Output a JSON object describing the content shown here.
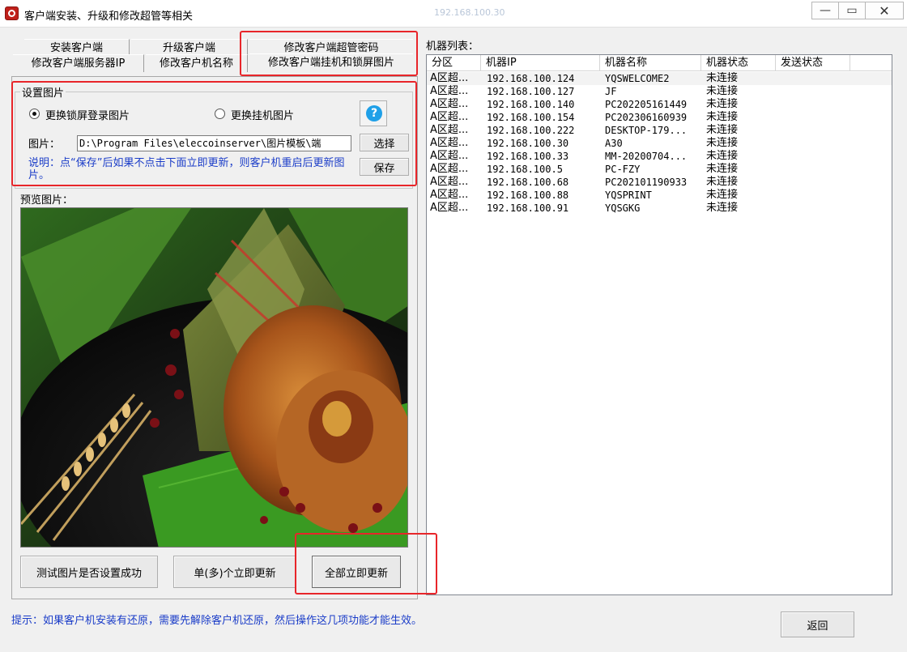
{
  "window": {
    "title": "客户端安装、升级和修改超管等相关",
    "ghost_text": "192.168.100.30",
    "minimize": "—",
    "maximize": "▭",
    "close": "✕"
  },
  "tabs": [
    {
      "label": "安装客户端"
    },
    {
      "label": "升级客户端"
    },
    {
      "label": "修改客户端超管密码"
    },
    {
      "label": "修改客户端服务器IP"
    },
    {
      "label": "修改客户机名称"
    },
    {
      "label": "修改客户端挂机和锁屏图片"
    }
  ],
  "settings": {
    "group_label": "设置图片",
    "radio_lock_label": "更换锁屏登录图片",
    "radio_idle_label": "更换挂机图片",
    "help_label": "?",
    "path_label": "图片：",
    "path_value": "D:\\Program Files\\eleccoinserver\\图片模板\\端",
    "choose_button": "选择",
    "save_button": "保存",
    "note": "说明：点“保存”后如果不点击下面立即更新，则客户机重启后更新图片。"
  },
  "preview": {
    "label": "预览图片："
  },
  "actions": {
    "test_button": "测试图片是否设置成功",
    "single_update_button": "单(多)个立即更新",
    "all_update_button": "全部立即更新",
    "back_button": "返回"
  },
  "hint": "提示：如果客户机安装有还原，需要先解除客户机还原，然后操作这几项功能才能生效。",
  "machine_list": {
    "label": "机器列表：",
    "columns": [
      "分区",
      "机器IP",
      "机器名称",
      "机器状态",
      "发送状态"
    ],
    "rows": [
      {
        "zone": "A区超...",
        "ip": "192.168.100.124",
        "name": "YQSWELCOME2",
        "status": "未连接",
        "send": ""
      },
      {
        "zone": "A区超...",
        "ip": "192.168.100.127",
        "name": "JF",
        "status": "未连接",
        "send": ""
      },
      {
        "zone": "A区超...",
        "ip": "192.168.100.140",
        "name": "PC202205161449",
        "status": "未连接",
        "send": ""
      },
      {
        "zone": "A区超...",
        "ip": "192.168.100.154",
        "name": "PC202306160939",
        "status": "未连接",
        "send": ""
      },
      {
        "zone": "A区超...",
        "ip": "192.168.100.222",
        "name": "DESKTOP-179...",
        "status": "未连接",
        "send": ""
      },
      {
        "zone": "A区超...",
        "ip": "192.168.100.30",
        "name": "A30",
        "status": "未连接",
        "send": ""
      },
      {
        "zone": "A区超...",
        "ip": "192.168.100.33",
        "name": "MM-20200704...",
        "status": "未连接",
        "send": ""
      },
      {
        "zone": "A区超...",
        "ip": "192.168.100.5",
        "name": "PC-FZY",
        "status": "未连接",
        "send": ""
      },
      {
        "zone": "A区超...",
        "ip": "192.168.100.68",
        "name": "PC202101190933",
        "status": "未连接",
        "send": ""
      },
      {
        "zone": "A区超...",
        "ip": "192.168.100.88",
        "name": "YQSPRINT",
        "status": "未连接",
        "send": ""
      },
      {
        "zone": "A区超...",
        "ip": "192.168.100.91",
        "name": "YQSGKG",
        "status": "未连接",
        "send": ""
      }
    ]
  },
  "colors": {
    "highlight_red": "#e8252a",
    "note_blue": "#1a3cc8",
    "help_blue": "#1fa0e8"
  }
}
